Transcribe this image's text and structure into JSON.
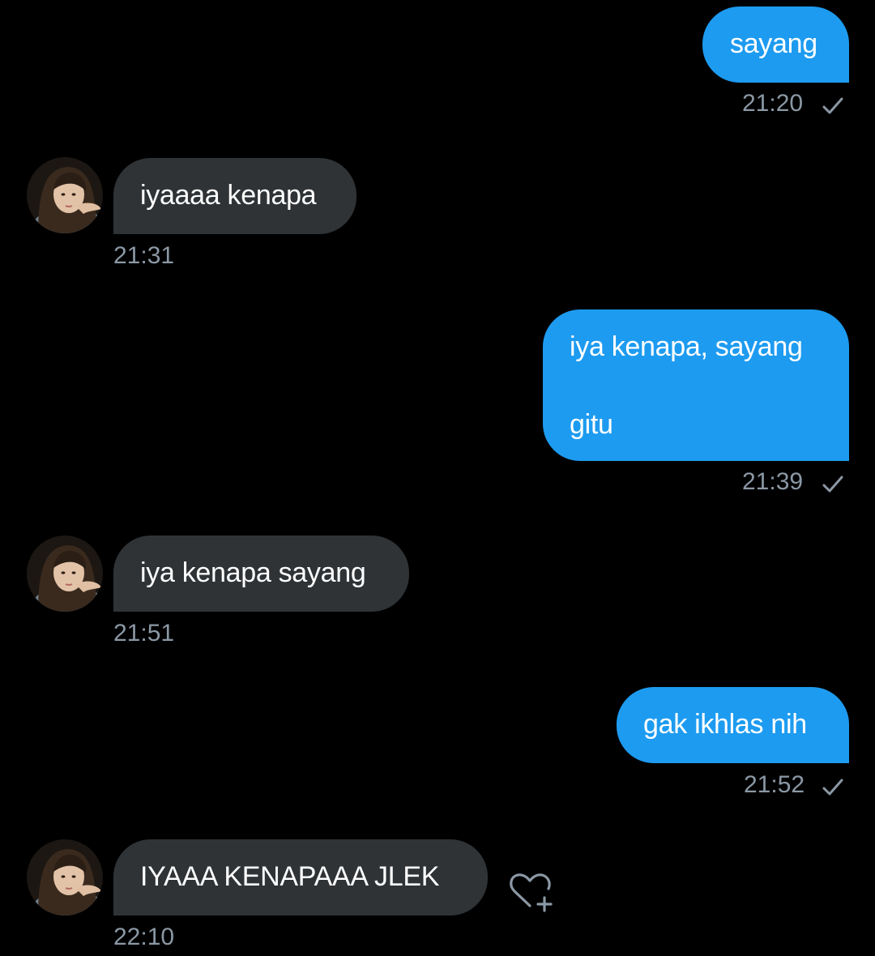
{
  "colors": {
    "background": "#000000",
    "sent_bubble": "#1d9bf0",
    "received_bubble": "#2f3336",
    "timestamp": "#8b98a5"
  },
  "messages": [
    {
      "direction": "sent",
      "lines": [
        "sayang"
      ],
      "time": "21:20",
      "status_icon": "checkmark-icon"
    },
    {
      "direction": "received",
      "lines": [
        "iyaaaa kenapa"
      ],
      "time": "21:31",
      "avatar": "contact-avatar"
    },
    {
      "direction": "sent",
      "lines": [
        "iya kenapa, sayang",
        "gitu"
      ],
      "time": "21:39",
      "status_icon": "checkmark-icon"
    },
    {
      "direction": "received",
      "lines": [
        "iya kenapa sayang"
      ],
      "time": "21:51",
      "avatar": "contact-avatar"
    },
    {
      "direction": "sent",
      "lines": [
        "gak ikhlas nih"
      ],
      "time": "21:52",
      "status_icon": "checkmark-icon"
    },
    {
      "direction": "received",
      "lines": [
        "IYAAA KENAPAAA JLEK"
      ],
      "time": "22:10",
      "avatar": "contact-avatar",
      "action_icon": "add-reaction-heart-icon"
    }
  ]
}
